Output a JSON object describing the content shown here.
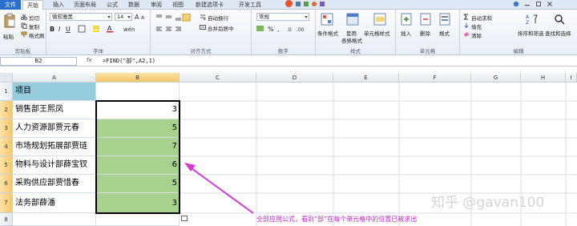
{
  "tabs": [
    "文件",
    "开始",
    "插入",
    "页面布局",
    "公式",
    "数据",
    "审阅",
    "视图",
    "新建选项卡",
    "开发工具"
  ],
  "active_tab": "开始",
  "ribbon": {
    "clipboard": {
      "paste": "粘贴",
      "cut": "剪切",
      "copy": "复制",
      "format_painter": "格式刷",
      "label": "剪贴板"
    },
    "font": {
      "name": "微软雅黑",
      "size": "14",
      "label": "字体"
    },
    "alignment": {
      "wrap": "自动换行",
      "merge": "合并后居中",
      "label": "对齐方式"
    },
    "number": {
      "format": "常规",
      "label": "数字"
    },
    "styles": {
      "conditional": "条件格式",
      "table": "套用\n表格格式",
      "cell_style": "单元格样式",
      "label": "样式"
    },
    "cells": {
      "insert": "插入",
      "delete": "删除",
      "format": "格式",
      "label": "单元格"
    },
    "editing": {
      "autosum": "自动求和",
      "fill": "填充",
      "clear": "清除",
      "sort": "排序和筛选",
      "find": "查找和选择",
      "label": "编辑"
    }
  },
  "formula_bar": {
    "name_box": "B2",
    "fx": "fx",
    "formula": "=FIND(\"部\",A2,1)"
  },
  "columns": [
    "A",
    "B",
    "C",
    "D",
    "E",
    "F",
    "G",
    "H",
    "I"
  ],
  "rows": [
    {
      "num": "1",
      "a": "项目",
      "b": ""
    },
    {
      "num": "2",
      "a": "销售部王熙凤",
      "b": "3"
    },
    {
      "num": "3",
      "a": "人力资源部贾元春",
      "b": "5"
    },
    {
      "num": "4",
      "a": "市场规划拓展部贾琏",
      "b": "7"
    },
    {
      "num": "5",
      "a": "物料与设计部薛宝钗",
      "b": "6"
    },
    {
      "num": "6",
      "a": "采购供应部贾惜春",
      "b": "5"
    },
    {
      "num": "7",
      "a": "法务部薛潘",
      "b": "3"
    },
    {
      "num": "8",
      "a": "",
      "b": ""
    }
  ],
  "annotation": "全部应用公式，看到“部”在每个单元格中的位置已被求出",
  "watermark": "知乎 @gavan100",
  "colors": {
    "header_fill": "#95cddc",
    "result_fill": "#a9d18e",
    "arrow": "#d63ad8",
    "annotation": "#c026c9"
  }
}
